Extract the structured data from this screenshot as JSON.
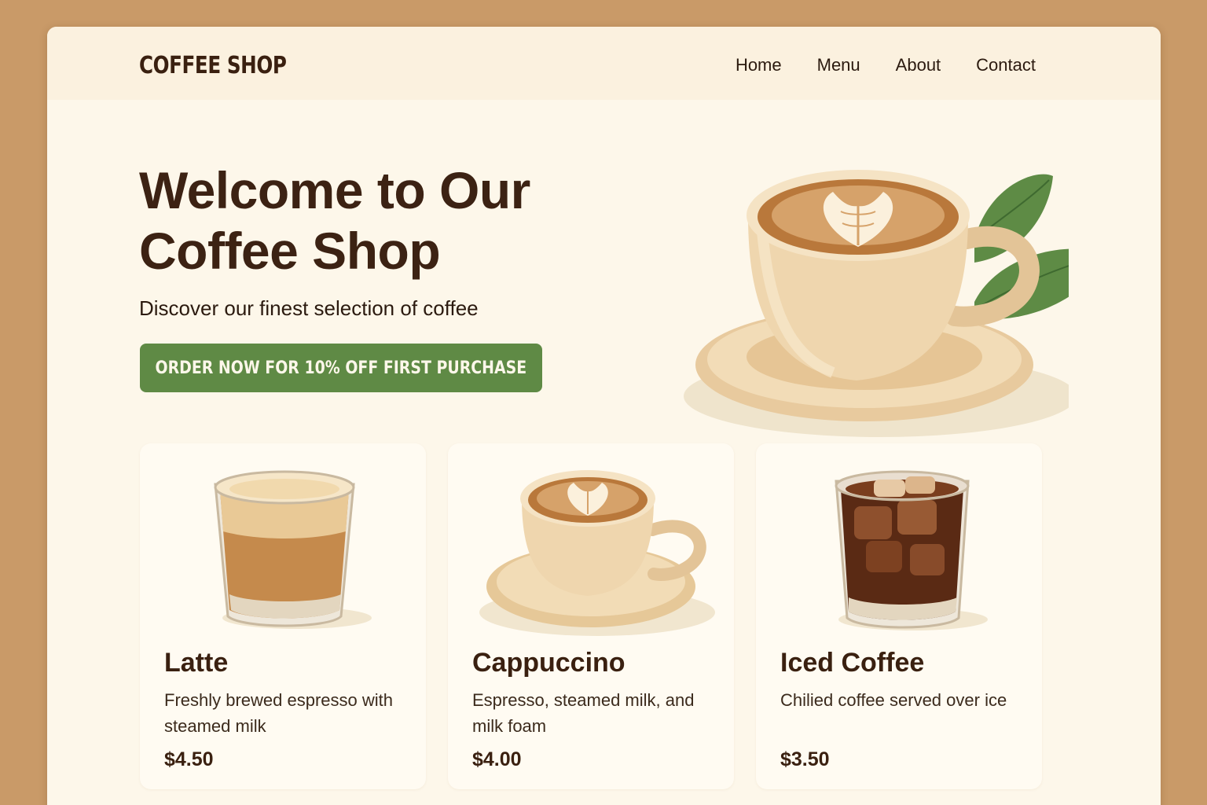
{
  "header": {
    "logo": "COFFEE SHOP",
    "nav": [
      "Home",
      "Menu",
      "About",
      "Contact"
    ]
  },
  "hero": {
    "title_line1": "Welcome to Our",
    "title_line2": "Coffee Shop",
    "subtitle": "Discover our finest selection of coffee",
    "cta_label": "ORDER NOW FOR 10% OFF FIRST PURCHASE",
    "image_icon": "cappuccino-cup-with-leaves-icon"
  },
  "products": [
    {
      "name": "Latte",
      "description": "Freshly brewed espresso with steamed milk",
      "price": "$4.50",
      "icon": "latte-glass-icon"
    },
    {
      "name": "Cappuccino",
      "description": "Espresso, steamed milk, and milk foam",
      "price": "$4.00",
      "icon": "cappuccino-cup-icon"
    },
    {
      "name": "Iced Coffee",
      "description": "Chilied coffee served over ice",
      "price": "$3.50",
      "icon": "iced-coffee-glass-icon"
    }
  ],
  "colors": {
    "background": "#c99a68",
    "page": "#fdf7ea",
    "header": "#fbf1df",
    "brand_dark": "#3c2213",
    "cta_green": "#5f8a45"
  }
}
